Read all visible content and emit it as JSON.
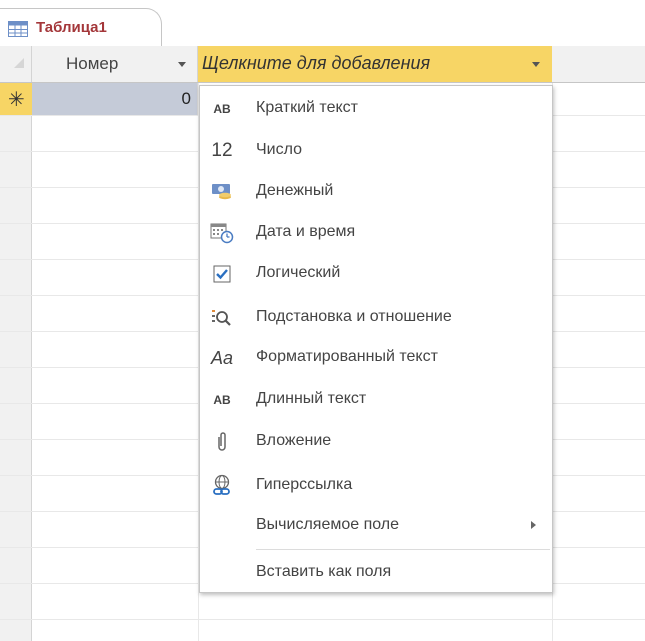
{
  "tab": {
    "title": "Таблица1",
    "icon": "table-icon"
  },
  "columns": [
    {
      "label": "Номер"
    },
    {
      "label": "Щелкните для добавления"
    }
  ],
  "new_row": {
    "marker": "✳",
    "value": "0"
  },
  "menu": {
    "items": [
      {
        "label": "Краткий текст",
        "icon": "short-text-icon",
        "glyph": "AB"
      },
      {
        "label": "Число",
        "icon": "number-icon",
        "glyph": "12"
      },
      {
        "label": "Денежный",
        "icon": "currency-icon"
      },
      {
        "label": "Дата и время",
        "icon": "date-time-icon"
      },
      {
        "label": "Логический",
        "icon": "checkbox-icon"
      },
      {
        "label": "Подстановка и отношение",
        "icon": "lookup-icon"
      },
      {
        "label": "Форматированный текст",
        "icon": "rich-text-icon",
        "glyph": "Aa"
      },
      {
        "label": "Длинный текст",
        "icon": "long-text-icon",
        "glyph": "AB"
      },
      {
        "label": "Вложение",
        "icon": "attachment-icon"
      },
      {
        "label": "Гиперссылка",
        "icon": "hyperlink-icon"
      },
      {
        "label": "Вычисляемое поле",
        "icon": "chevron-right-icon"
      },
      {
        "label": "Вставить как поля"
      }
    ]
  },
  "colors": {
    "accent": "#f7d565",
    "tab_text": "#a4373a",
    "selected_cell": "#c5cbd8"
  }
}
